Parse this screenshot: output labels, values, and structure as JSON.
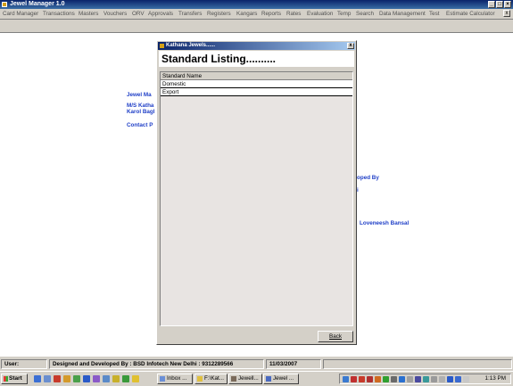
{
  "app": {
    "title": "Jewel Manager 1.0"
  },
  "menu": {
    "items": [
      "Card Manager",
      "Transactions",
      "Masters",
      "Vouchers",
      "ORV",
      "Approvals",
      "Transfers",
      "Registers",
      "Kangars",
      "Reports",
      "Rates",
      "Evaluation",
      "Temp",
      "Search",
      "Data Management",
      "Test",
      "Estimate Calculator"
    ],
    "close_label": "x"
  },
  "background_text": {
    "line1": "Jewel Ma",
    "line2": "M/S Katha",
    "line3": "Karol Bagl",
    "line4": "Contact P",
    "line5": "oped By",
    "line6": "i",
    "line7": "Loveneesh Bansal"
  },
  "dialog": {
    "title": "Kathana Jewels......",
    "close_label": "x",
    "heading": "Standard Listing..........",
    "column_header": "Standard Name",
    "rows": [
      "Domestic",
      "Export"
    ],
    "back_label": "Back"
  },
  "statusbar": {
    "user_label": "User:",
    "designer": "Designed and Developed By : BSD Infotech New Delhi : 9312289566",
    "date": "11/03/2007"
  },
  "taskbar": {
    "start_label": "Start",
    "tasks": [
      "Inbox ...",
      "F:\\Kat...",
      "Jewell...",
      "Jewel ..."
    ],
    "clock": "1:13 PM"
  }
}
